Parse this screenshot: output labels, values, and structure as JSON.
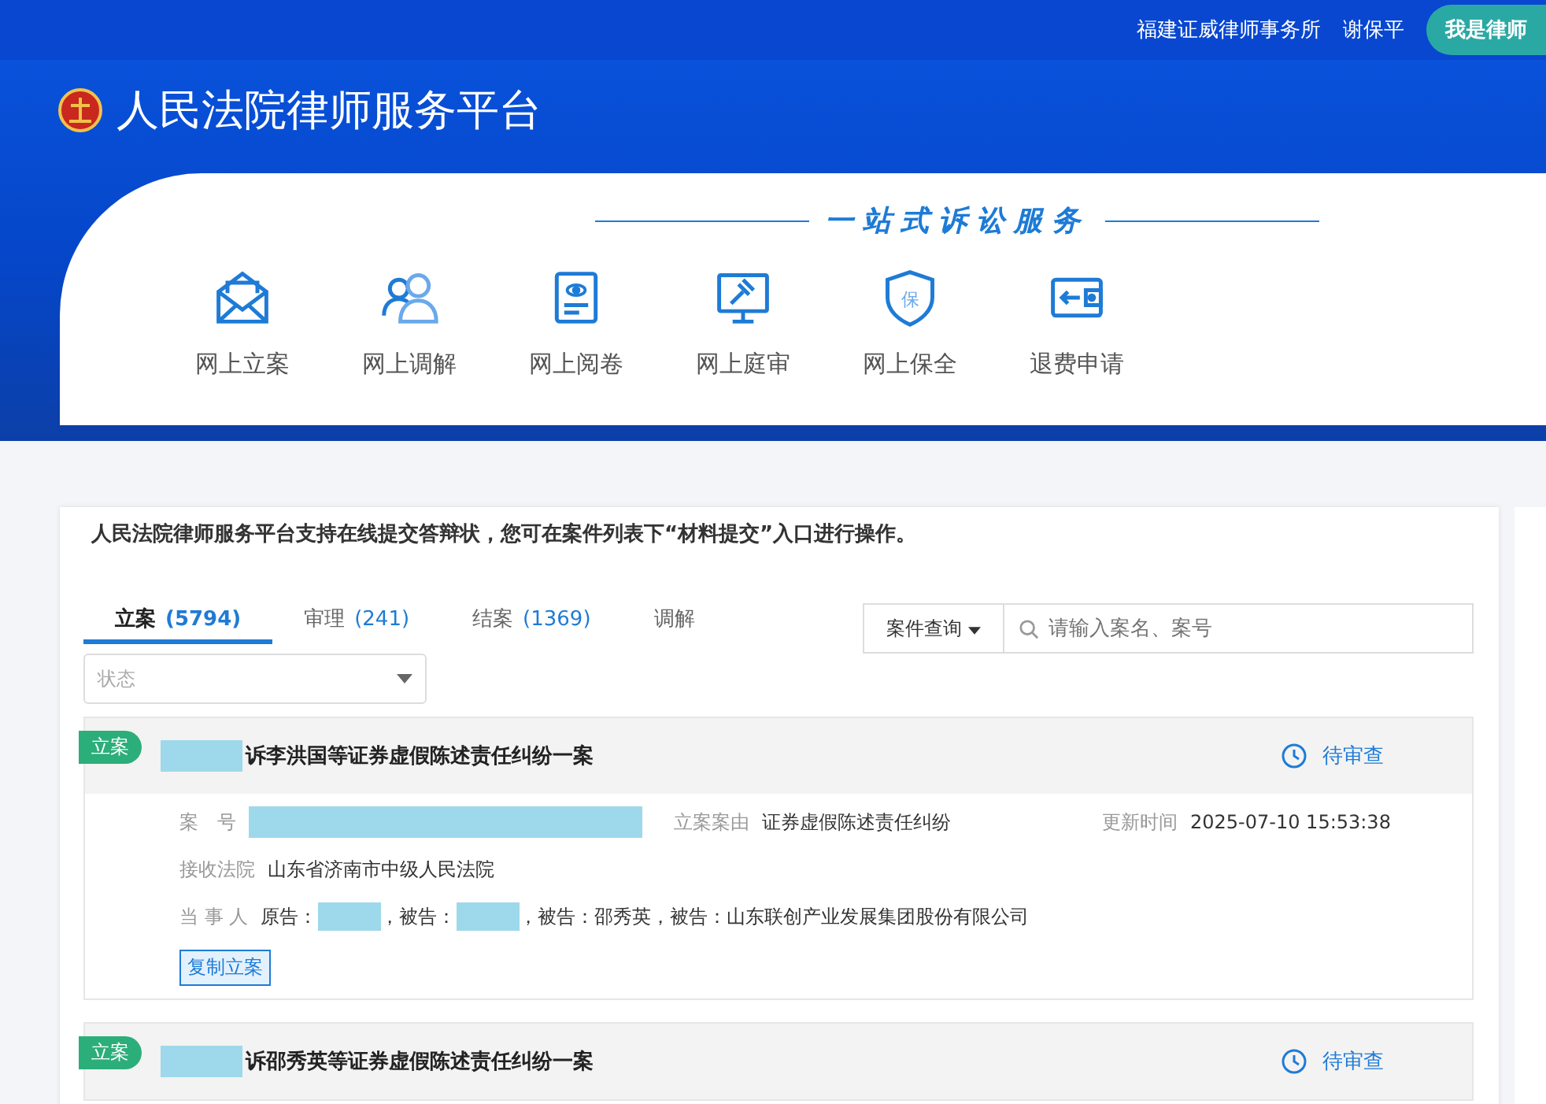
{
  "header": {
    "firm": "福建证威律师事务所",
    "user": "谢保平",
    "role_button": "我是律师",
    "title": "人民法院律师服务平台"
  },
  "services": {
    "slogan": "一站式诉讼服务",
    "items": [
      {
        "kind": "envelope",
        "label": "网上立案"
      },
      {
        "kind": "people",
        "label": "网上调解"
      },
      {
        "kind": "document",
        "label": "网上阅卷"
      },
      {
        "kind": "monitor",
        "label": "网上庭审"
      },
      {
        "kind": "shield",
        "label": "网上保全",
        "icon_text": "保"
      },
      {
        "kind": "wallet",
        "label": "退费申请"
      }
    ]
  },
  "notice": "人民法院律师服务平台支持在线提交答辩状，您可在案件列表下“材料提交”入口进行操作。",
  "tabs": [
    {
      "label": "立案",
      "count": "(5794)",
      "selected": true
    },
    {
      "label": "审理",
      "count": "(241)",
      "selected": false
    },
    {
      "label": "结案",
      "count": "(1369)",
      "selected": false
    },
    {
      "label": "调解",
      "selected": false
    }
  ],
  "search": {
    "dropdown": "案件查询",
    "placeholder": "请输入案名、案号"
  },
  "status_filter": {
    "placeholder": "状态"
  },
  "cases": [
    {
      "tag": "立案",
      "title": "诉李洪国等证券虚假陈述责任纠纷一案",
      "status": "待审查",
      "fields": {
        "case_no_label": "案　号",
        "cause_label": "立案案由",
        "cause": "证券虚假陈述责任纠纷",
        "updated_label": "更新时间",
        "updated": "2025-07-10 15:53:38",
        "court_label": "接收法院",
        "court": "山东省济南市中级人民法院",
        "parties_label": "当 事 人"
      },
      "parties": [
        {
          "kind": "text",
          "text": "原告："
        },
        {
          "kind": "redacted"
        },
        {
          "kind": "text",
          "text": "，被告："
        },
        {
          "kind": "redacted"
        },
        {
          "kind": "text",
          "text": "，被告：邵秀英，被告：山东联创产业发展集团股份有限公司"
        }
      ],
      "action": "复制立案"
    },
    {
      "tag": "立案",
      "title": "诉邵秀英等证券虚假陈述责任纠纷一案",
      "status": "待审查"
    }
  ]
}
